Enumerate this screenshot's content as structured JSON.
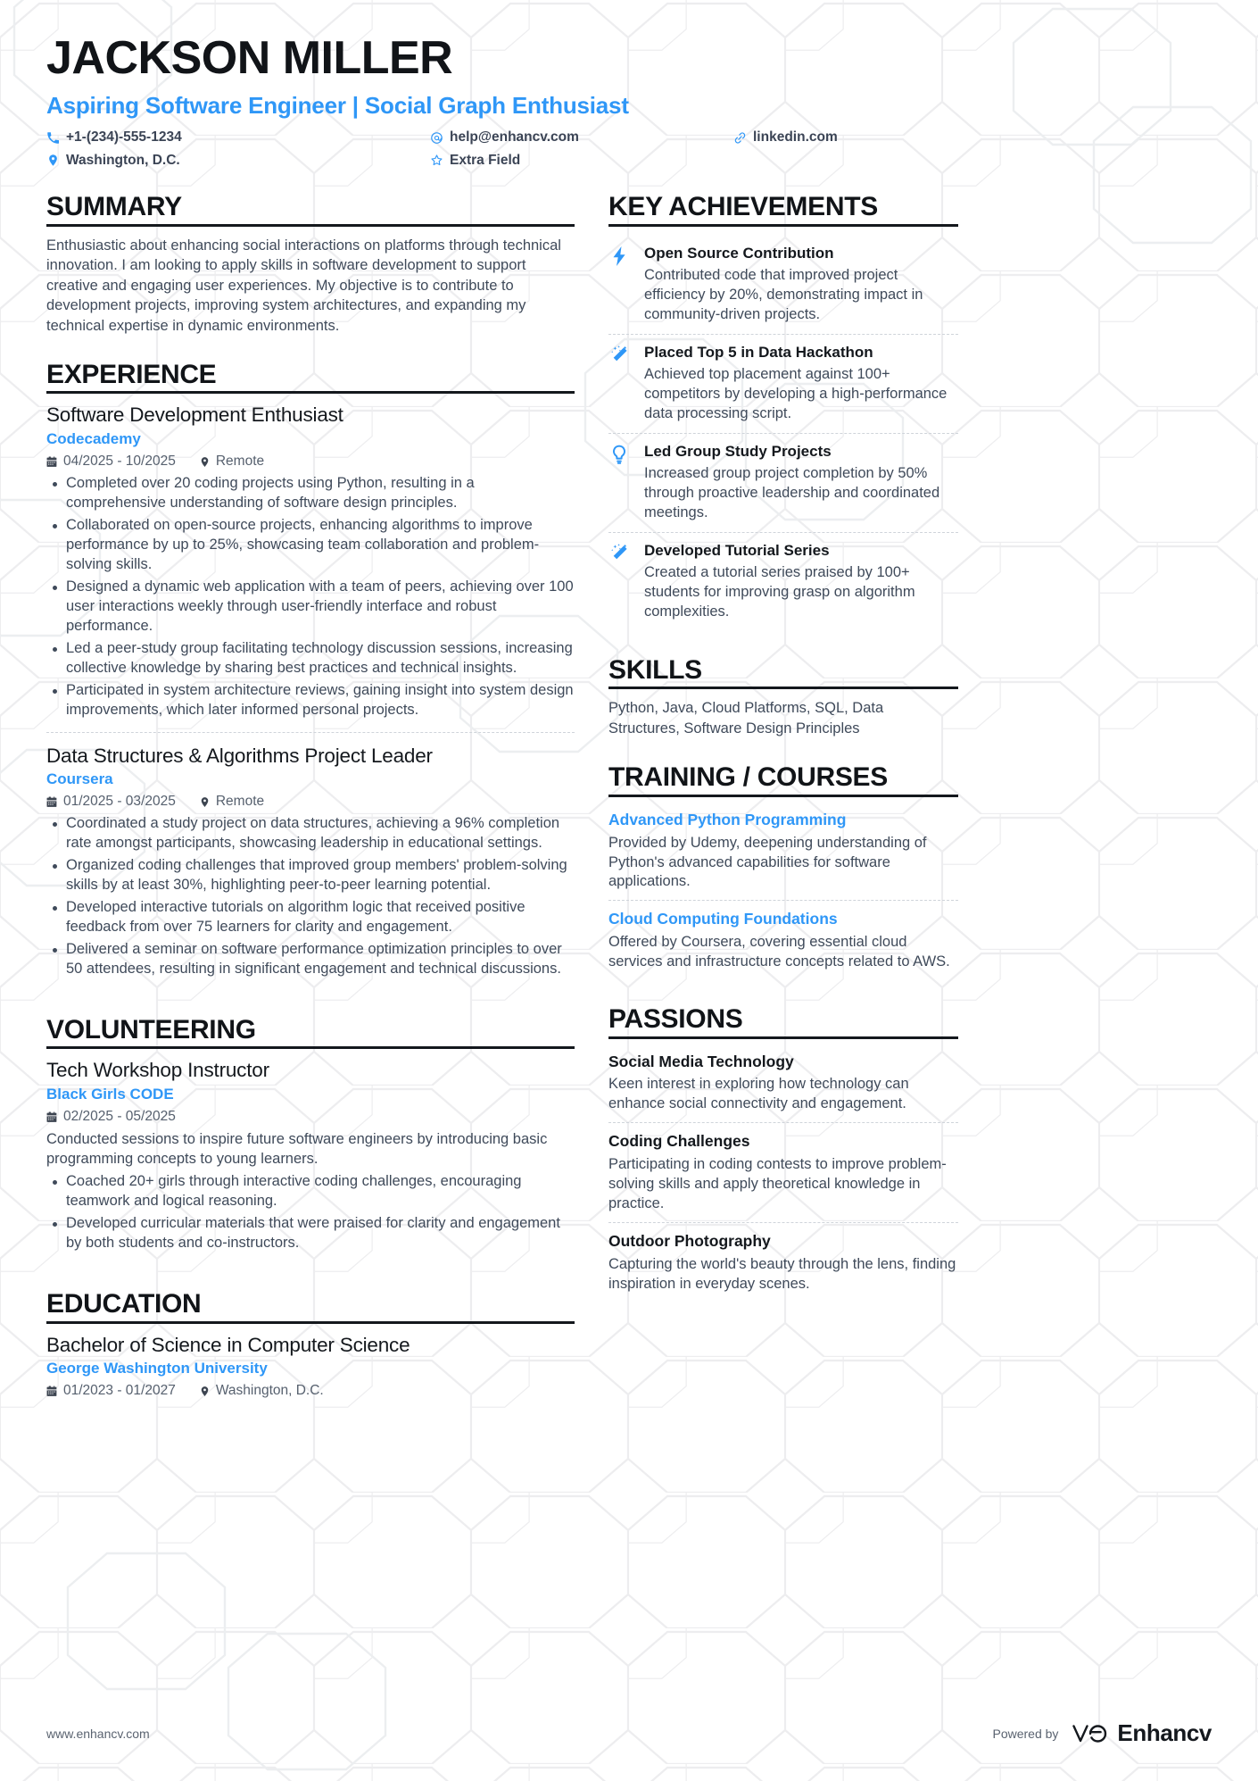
{
  "header": {
    "name": "JACKSON MILLER",
    "headline": "Aspiring Software Engineer | Social Graph Enthusiast",
    "contacts": [
      {
        "icon": "phone-icon",
        "text": "+1-(234)-555-1234"
      },
      {
        "icon": "email-icon",
        "text": "help@enhancv.com"
      },
      {
        "icon": "link-icon",
        "text": "linkedin.com"
      },
      {
        "icon": "location-icon",
        "text": "Washington, D.C."
      },
      {
        "icon": "star-icon",
        "text": "Extra Field"
      }
    ]
  },
  "summary": {
    "title": "SUMMARY",
    "text": "Enthusiastic about enhancing social interactions on platforms through technical innovation. I am looking to apply skills in software development to support creative and engaging user experiences. My objective is to contribute to development projects, improving system architectures, and expanding my technical expertise in dynamic environments."
  },
  "experience": {
    "title": "EXPERIENCE",
    "entries": [
      {
        "role": "Software Development Enthusiast",
        "org": "Codecademy",
        "dates": "04/2025 - 10/2025",
        "location": "Remote",
        "bullets": [
          "Completed over 20 coding projects using Python, resulting in a comprehensive understanding of software design principles.",
          "Collaborated on open-source projects, enhancing algorithms to improve performance by up to 25%, showcasing team collaboration and problem-solving skills.",
          "Designed a dynamic web application with a team of peers, achieving over 100 user interactions weekly through user-friendly interface and robust performance.",
          "Led a peer-study group facilitating technology discussion sessions, increasing collective knowledge by sharing best practices and technical insights.",
          "Participated in system architecture reviews, gaining insight into system design improvements, which later informed personal projects."
        ]
      },
      {
        "role": "Data Structures & Algorithms Project Leader",
        "org": "Coursera",
        "dates": "01/2025 - 03/2025",
        "location": "Remote",
        "bullets": [
          "Coordinated a study project on data structures, achieving a 96% completion rate amongst participants, showcasing leadership in educational settings.",
          "Organized coding challenges that improved group members' problem-solving skills by at least 30%, highlighting peer-to-peer learning potential.",
          "Developed interactive tutorials on algorithm logic that received positive feedback from over 75 learners for clarity and engagement.",
          "Delivered a seminar on software performance optimization principles to over 50 attendees, resulting in significant engagement and technical discussions."
        ]
      }
    ]
  },
  "volunteering": {
    "title": "VOLUNTEERING",
    "entries": [
      {
        "role": "Tech Workshop Instructor",
        "org": "Black Girls CODE",
        "dates": "02/2025 - 05/2025",
        "location": "",
        "description": "Conducted sessions to inspire future software engineers by introducing basic programming concepts to young learners.",
        "bullets": [
          "Coached 20+ girls through interactive coding challenges, encouraging teamwork and logical reasoning.",
          "Developed curricular materials that were praised for clarity and engagement by both students and co-instructors."
        ]
      }
    ]
  },
  "education": {
    "title": "EDUCATION",
    "entries": [
      {
        "degree": "Bachelor of Science in Computer Science",
        "school": "George Washington University",
        "dates": "01/2023 - 01/2027",
        "location": "Washington, D.C."
      }
    ]
  },
  "key_achievements": {
    "title": "KEY ACHIEVEMENTS",
    "items": [
      {
        "icon": "lightning-bolt-icon",
        "title": "Open Source Contribution",
        "description": "Contributed code that improved project efficiency by 20%, demonstrating impact in community-driven projects."
      },
      {
        "icon": "magic-wand-icon",
        "title": "Placed Top 5 in Data Hackathon",
        "description": "Achieved top placement against 100+ competitors by developing a high-performance data processing script."
      },
      {
        "icon": "lightbulb-icon",
        "title": "Led Group Study Projects",
        "description": "Increased group project completion by 50% through proactive leadership and coordinated meetings."
      },
      {
        "icon": "magic-wand-icon",
        "title": "Developed Tutorial Series",
        "description": "Created a tutorial series praised by 100+ students for improving grasp on algorithm complexities."
      }
    ]
  },
  "skills": {
    "title": "SKILLS",
    "text": "Python, Java, Cloud Platforms, SQL, Data Structures, Software Design Principles"
  },
  "training": {
    "title": "TRAINING / COURSES",
    "items": [
      {
        "title": "Advanced Python Programming",
        "description": "Provided by Udemy, deepening understanding of Python's advanced capabilities for software applications."
      },
      {
        "title": "Cloud Computing Foundations",
        "description": "Offered by Coursera, covering essential cloud services and infrastructure concepts related to AWS."
      }
    ]
  },
  "passions": {
    "title": "PASSIONS",
    "items": [
      {
        "title": "Social Media Technology",
        "description": "Keen interest in exploring how technology can enhance social connectivity and engagement."
      },
      {
        "title": "Coding Challenges",
        "description": "Participating in coding contests to improve problem-solving skills and apply theoretical knowledge in practice."
      },
      {
        "title": "Outdoor Photography",
        "description": "Capturing the world's beauty through the lens, finding inspiration in everyday scenes."
      }
    ]
  },
  "footer": {
    "url": "www.enhancv.com",
    "powered_by": "Powered by",
    "brand": "Enhancv"
  },
  "colors": {
    "accent": "#2f97f7",
    "ink": "#14181d",
    "body": "#3f4a5a",
    "watermark": "#eceef0"
  }
}
